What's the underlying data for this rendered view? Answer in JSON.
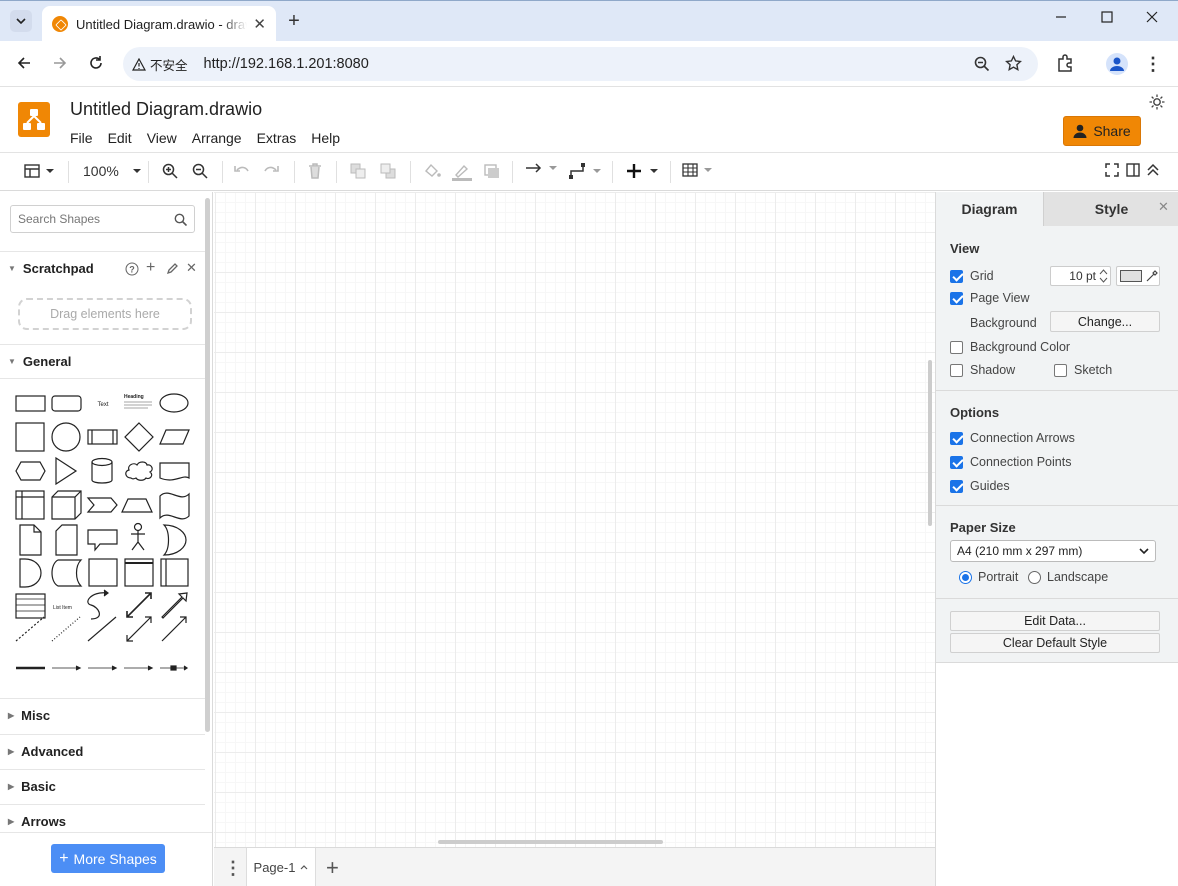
{
  "browser": {
    "tab_title": "Untitled Diagram.drawio - draw.io",
    "security_label": "不安全",
    "url": "http://192.168.1.201:8080"
  },
  "app": {
    "title": "Untitled Diagram.drawio",
    "menu": [
      "File",
      "Edit",
      "View",
      "Arrange",
      "Extras",
      "Help"
    ],
    "share_label": "Share",
    "zoom": "100%"
  },
  "left": {
    "search_placeholder": "Search Shapes",
    "scratchpad_label": "Scratchpad",
    "drag_hint": "Drag elements here",
    "general_label": "General",
    "sections": [
      "Misc",
      "Advanced",
      "Basic",
      "Arrows"
    ],
    "more_shapes": "More Shapes",
    "shape_text_label": "Text",
    "shape_heading_label": "Heading",
    "shape_list_label": "List Item"
  },
  "right": {
    "tab_diagram": "Diagram",
    "tab_style": "Style",
    "view_label": "View",
    "grid_label": "Grid",
    "grid_size": "10 pt",
    "page_view_label": "Page View",
    "background_label": "Background",
    "change_label": "Change...",
    "bg_color_label": "Background Color",
    "shadow_label": "Shadow",
    "sketch_label": "Sketch",
    "options_label": "Options",
    "conn_arrows": "Connection Arrows",
    "conn_points": "Connection Points",
    "guides": "Guides",
    "paper_size_label": "Paper Size",
    "paper_size": "A4 (210 mm x 297 mm)",
    "portrait": "Portrait",
    "landscape": "Landscape",
    "edit_data": "Edit Data...",
    "clear_style": "Clear Default Style"
  },
  "pages": {
    "current": "Page-1"
  },
  "colors": {
    "brand": "#f08705",
    "accent": "#1a73e8",
    "more_shapes": "#4c8ef5"
  }
}
